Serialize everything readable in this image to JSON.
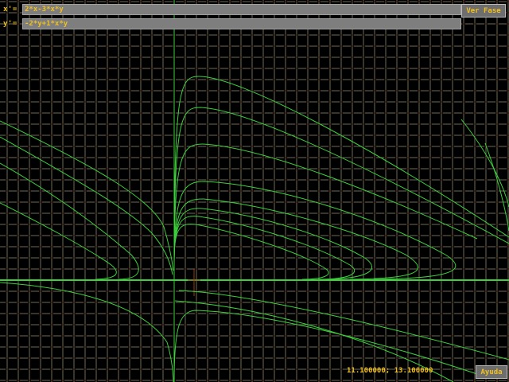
{
  "equations": {
    "x_label": "x'=",
    "x_value": "2*x-3*x*y",
    "y_label": "y'=",
    "y_value": "-2*y+1*x*y"
  },
  "buttons": {
    "phase_label": "Ver Fase",
    "help_label": "Ayuda"
  },
  "status": {
    "coordinates": "11.100000; 13.100000"
  },
  "colors": {
    "background": "#000000",
    "grid": "#6e6c58",
    "axis": "#3cd03c",
    "trajectory": "#3cd03c",
    "text": "#f0c020",
    "input_bg": "#7e7e7e",
    "field_marks": "#3a0e06"
  }
}
